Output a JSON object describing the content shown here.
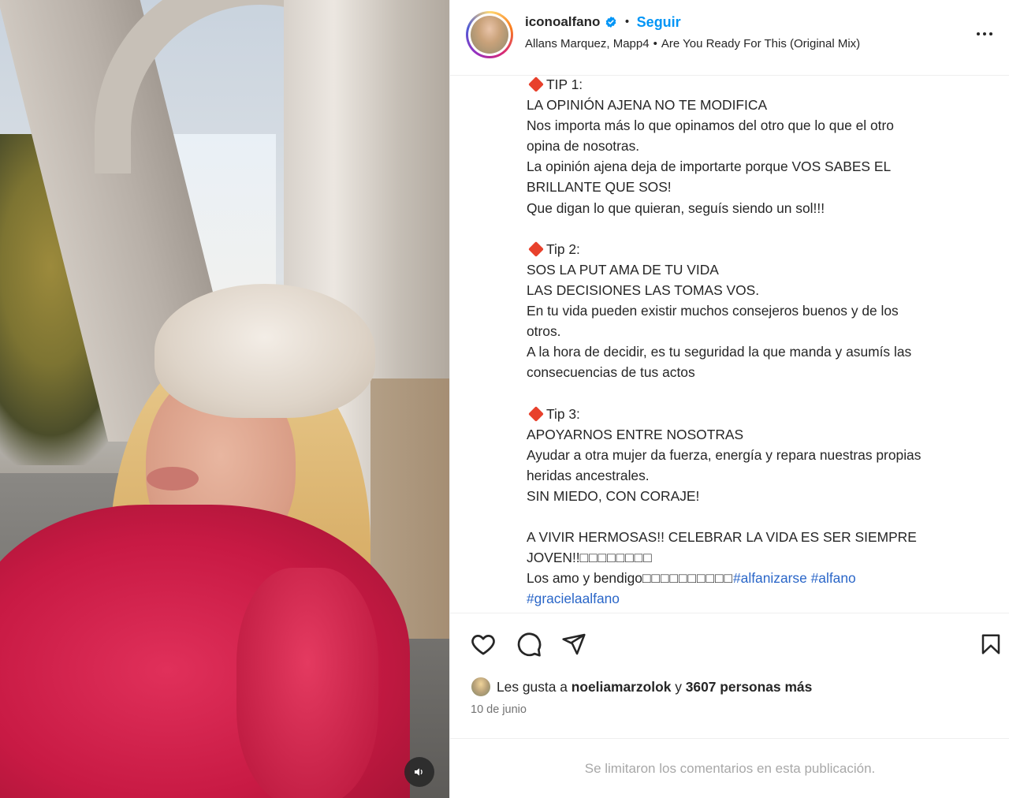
{
  "header": {
    "username": "iconoalfano",
    "separator": "•",
    "follow_label": "Seguir",
    "audio_artists": "Allans Marquez, Mapp4",
    "audio_separator": "•",
    "audio_track": "Are You Ready For This (Original Mix)"
  },
  "icons": {
    "verified": "verified-badge-icon",
    "more": "more-options-icon",
    "sound": "speaker-icon",
    "like": "heart-icon",
    "comment": "comment-bubble-icon",
    "share": "paper-plane-icon",
    "save": "bookmark-icon",
    "tip_marker": "red-diamond-emoji"
  },
  "colors": {
    "accent": "#0095f6",
    "verified": "#0095f6",
    "hashtag": "#2a66c8",
    "diamond": "#e8412c",
    "muted": "#737373"
  },
  "caption": {
    "tip1_title": "TIP 1:",
    "tip1_heading": "LA OPINIÓN AJENA NO TE MODIFICA",
    "tip1_l1": "Nos importa más lo que opinamos del otro que lo que el otro",
    "tip1_l2": "opina de nosotras.",
    "tip1_l3": "La opinión ajena deja de importarte porque VOS SABES EL",
    "tip1_l4": "BRILLANTE QUE SOS!",
    "tip1_l5": "Que digan lo que quieran, seguís siendo un sol!!!",
    "tip2_title": "Tip 2:",
    "tip2_heading1": "SOS LA PUT AMA DE TU VIDA",
    "tip2_heading2": "LAS DECISIONES LAS TOMAS VOS.",
    "tip2_l1": "En tu vida pueden existir muchos consejeros buenos y de los",
    "tip2_l2": "otros.",
    "tip2_l3": "A la hora de decidir, es tu seguridad la que manda y asumís las",
    "tip2_l4": "consecuencias de tus actos",
    "tip3_title": "Tip 3:",
    "tip3_heading": "APOYARNOS ENTRE NOSOTRAS",
    "tip3_l1": "Ayudar a otra mujer da fuerza, energía y repara nuestras propias",
    "tip3_l2": "heridas ancestrales.",
    "tip3_l3": "SIN MIEDO, CON CORAJE!",
    "closing_l1": "A VIVIR HERMOSAS!! CELEBRAR LA VIDA ES SER SIEMPRE",
    "closing_l2": "JOVEN!!",
    "closing_l2_tofu": "□□□□□□□□",
    "closing_l3": "Los amo y bendigo",
    "closing_l3_tofu": "□□□□□□□□□□",
    "hashtag1": "#alfanizarse",
    "hashtag2": "#alfano",
    "hashtag3": "#gracielaalfano"
  },
  "likes": {
    "prefix": "Les gusta a",
    "user": "noeliamarzolok",
    "connector": "y",
    "others": "3607 personas más"
  },
  "date": "10 de junio",
  "comments_notice": "Se limitaron los comentarios en esta publicación."
}
